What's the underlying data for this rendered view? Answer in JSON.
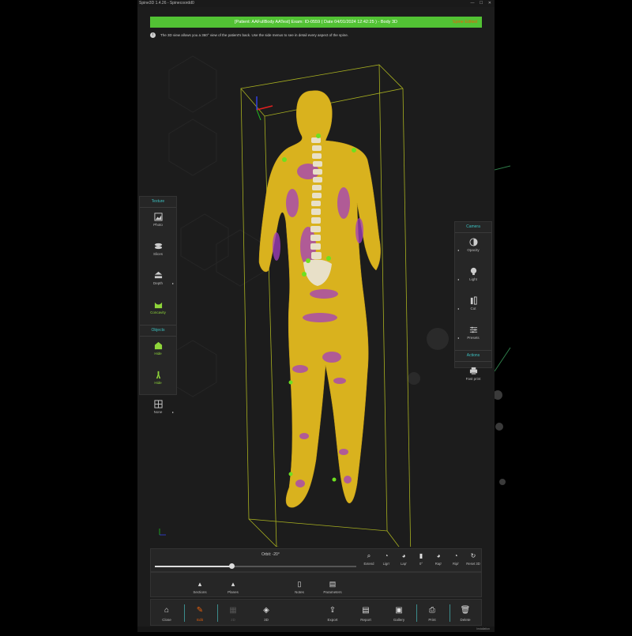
{
  "window": {
    "title": "Spine3D 1.4.26 - Spinecoordd0",
    "controls": [
      "—",
      "☐",
      "✕"
    ]
  },
  "header": {
    "title": "[Patient: AAFullBody AATest] Exam: ID-0559 ( Date 04/01/2024 12:42:25 ) - Body 3D",
    "status": "Spine Edited"
  },
  "info": {
    "text": "The 3D view allows you a 360° view of the patient's back. Use the side menus to see in detail every aspect of the spine."
  },
  "left_panel": {
    "texture_title": "Texture",
    "texture_items": [
      {
        "label": "Photo"
      },
      {
        "label": "Slices"
      },
      {
        "label": "Depth"
      },
      {
        "label": "Concavity"
      }
    ],
    "objects_title": "Objects",
    "object_items": [
      {
        "label": "Hide"
      },
      {
        "label": "Hide"
      },
      {
        "label": "None"
      }
    ]
  },
  "right_panel": {
    "camera_title": "Camera",
    "camera_items": [
      {
        "label": "Opacity"
      },
      {
        "label": "Light"
      },
      {
        "label": "Cut"
      },
      {
        "label": "Presets"
      }
    ],
    "actions_title": "Actions",
    "action_items": [
      {
        "label": "Fast print"
      }
    ]
  },
  "orbit": {
    "label": "Orbit: -20°",
    "value_fraction": 0.38
  },
  "view_buttons": [
    {
      "label": "Extend"
    },
    {
      "label": "Lign'"
    },
    {
      "label": "Lap'"
    },
    {
      "label": "0°"
    },
    {
      "label": "Rap'"
    },
    {
      "label": "Ripi'"
    },
    {
      "label": "Reset 3D"
    }
  ],
  "tools": [
    {
      "label": "Sections"
    },
    {
      "label": "Planes"
    },
    {
      "label": "Notes"
    },
    {
      "label": "Parameters"
    }
  ],
  "bottom": [
    {
      "label": "Close"
    },
    {
      "label": "Edit"
    },
    {
      "label": "2D"
    },
    {
      "label": "3D"
    },
    {
      "label": "Export"
    },
    {
      "label": "Report"
    },
    {
      "label": "Gallery"
    },
    {
      "label": "Print"
    },
    {
      "label": "Delete"
    }
  ],
  "statusbar": {
    "text": "Installation"
  },
  "colors": {
    "header_green": "#52c234",
    "accent_teal": "#3cc0c0",
    "active_green": "#8fd63a",
    "active_orange": "#e8600c",
    "body_yellow": "#d9b21e",
    "body_purple": "#a33fbf"
  }
}
